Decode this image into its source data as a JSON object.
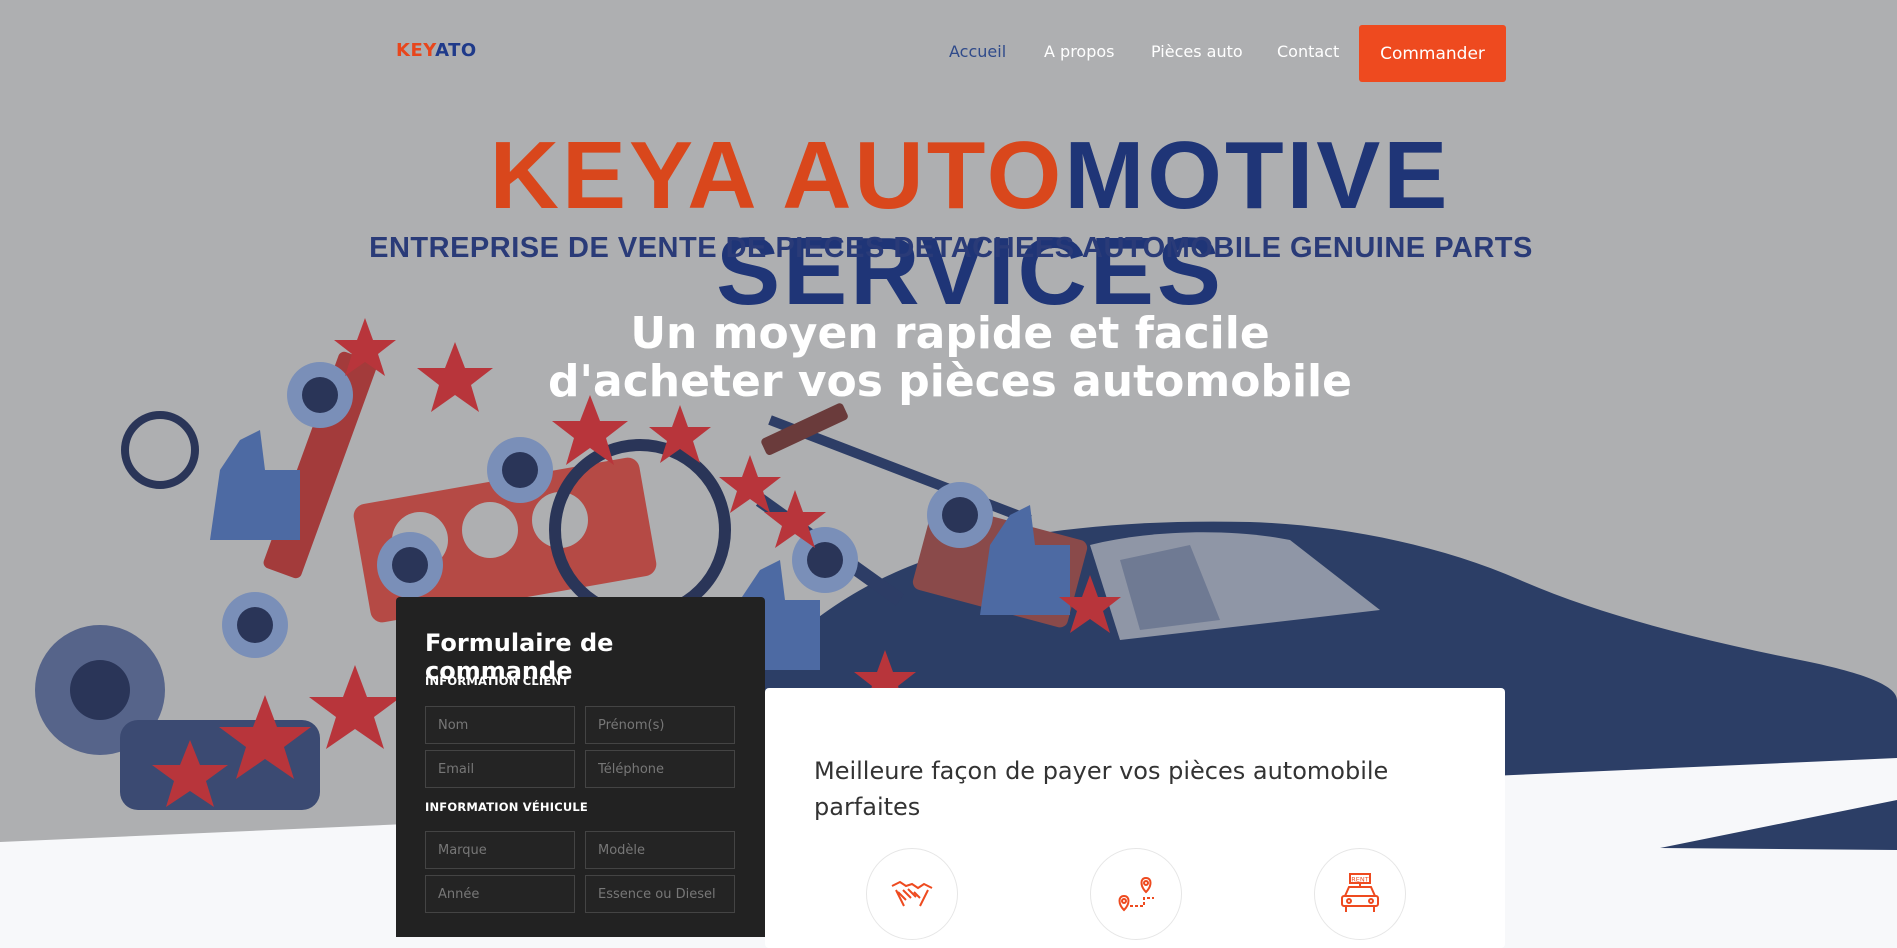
{
  "header": {
    "logo_part1": "KEY",
    "logo_part2": "ATO",
    "nav": [
      "Accueil",
      "A propos",
      "Pièces auto",
      "Contact"
    ],
    "cta_label": "Commander"
  },
  "hero": {
    "brand_part1": "KEYA AUTO",
    "brand_part2": "MOTIVE SERVICES",
    "brand_subtitle": "ENTREPRISE DE VENTE DE PIECES DETACHEES AUTOMOBILE GENUINE PARTS",
    "tagline_line1": "Un moyen rapide et facile",
    "tagline_line2": "d'acheter vos pièces automobile"
  },
  "order_form": {
    "title": "Formulaire de commande",
    "section_client": "INFORMATION CLIENT",
    "section_vehicle": "INFORMATION VÉHICULE",
    "placeholders": {
      "nom": "Nom",
      "prenom": "Prénom(s)",
      "email": "Email",
      "telephone": "Téléphone",
      "marque": "Marque",
      "modele": "Modèle",
      "annee": "Année",
      "carburant": "Essence ou Diesel"
    }
  },
  "card": {
    "title": "Meilleure façon de payer vos pièces automobile parfaites",
    "icons": [
      "handshake-icon",
      "route-pin-icon",
      "rent-car-icon"
    ],
    "icon_rent_text": "RENT"
  },
  "colors": {
    "accent": "#ee4a1f",
    "brand_blue": "#1f3577",
    "nav_active": "#2f4a8a",
    "hero_bg": "#aeafb1",
    "form_bg": "#222222"
  }
}
